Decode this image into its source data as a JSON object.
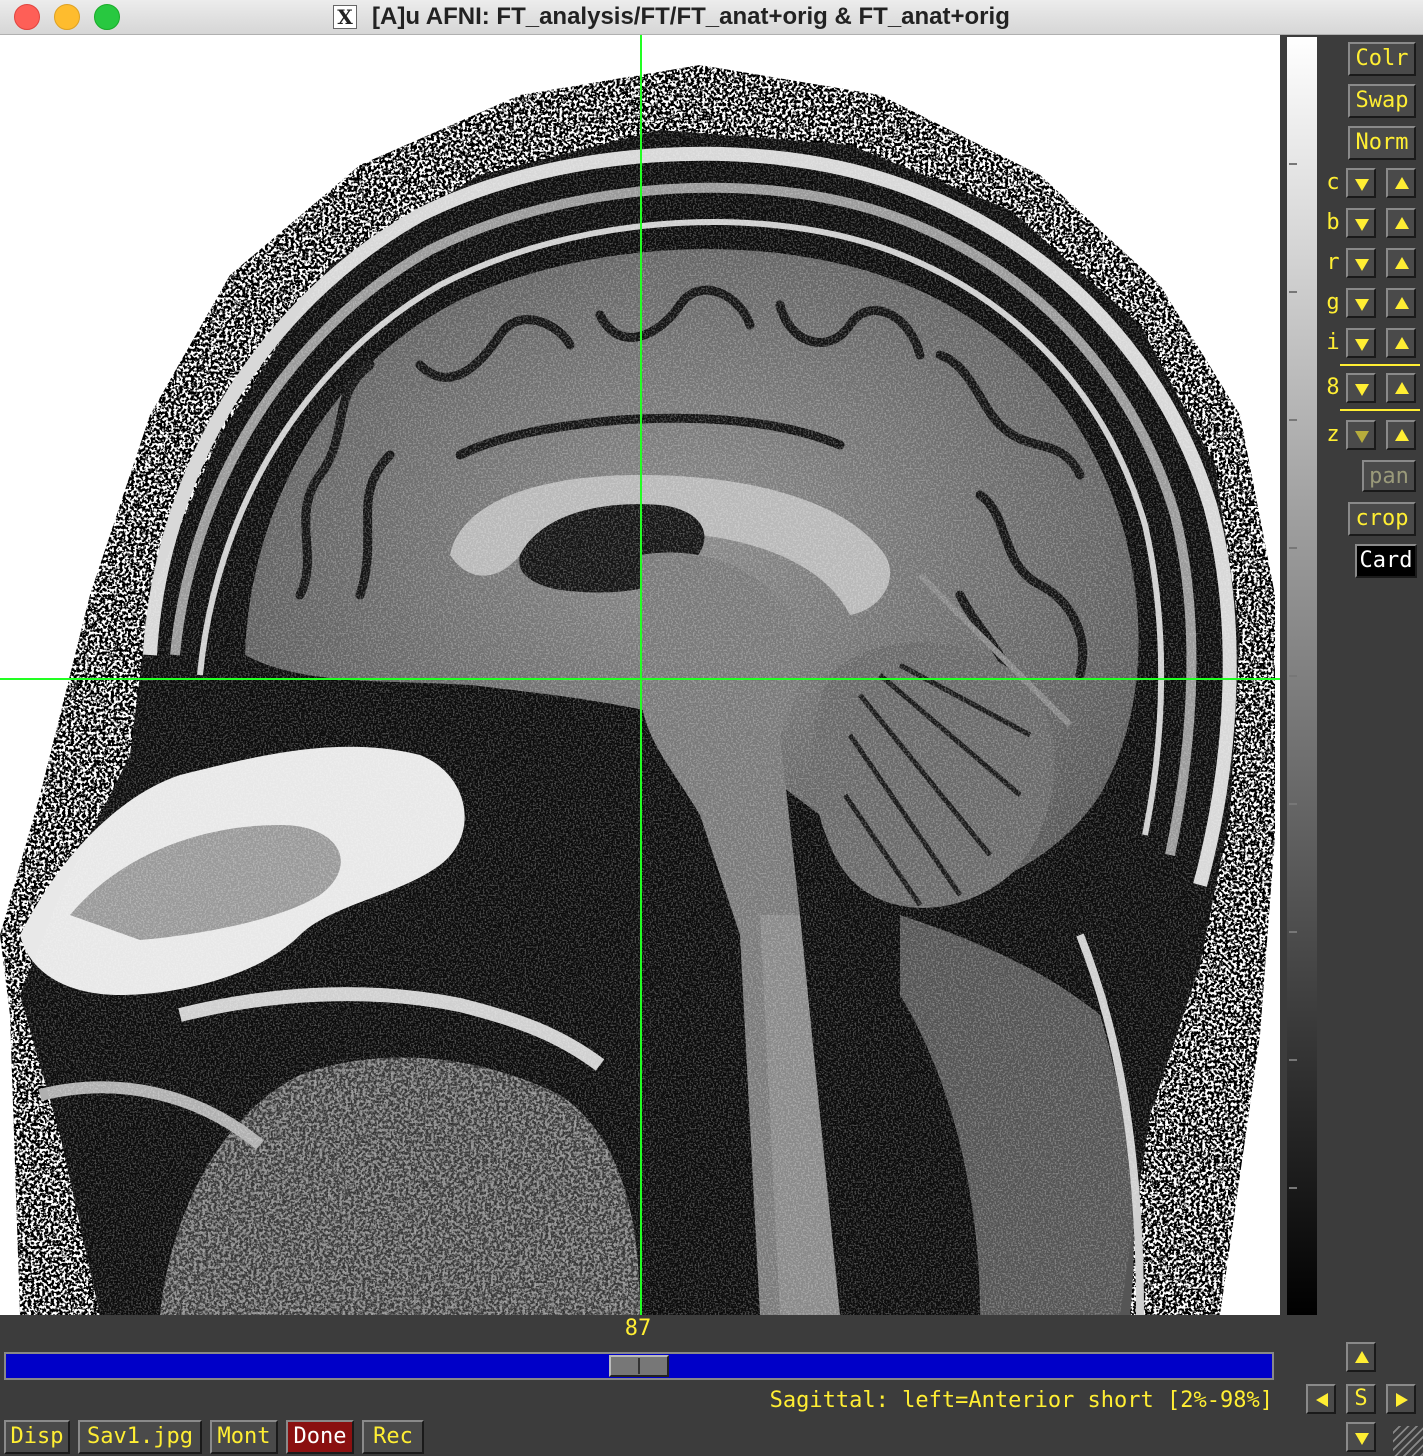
{
  "window": {
    "title": "[A]u AFNI: FT_analysis/FT/FT_anat+orig & FT_anat+orig",
    "x_icon": "X"
  },
  "image": {
    "description_icon": "mri-sagittal-brain",
    "crosshair_color": "#22ff22"
  },
  "side_buttons": {
    "colr": "Colr",
    "swap": "Swap",
    "norm": "Norm",
    "pan": "pan",
    "crop": "crop",
    "card": "Card"
  },
  "side_rows": [
    {
      "letter": "c"
    },
    {
      "letter": "b"
    },
    {
      "letter": "r"
    },
    {
      "letter": "g"
    },
    {
      "letter": "i"
    },
    {
      "letter": "8"
    },
    {
      "letter": "z"
    }
  ],
  "slice": {
    "number": "87",
    "position_fraction": 0.5
  },
  "status_text": "Sagittal: left=Anterior short [2%-98%]",
  "nav": {
    "s_label": "S"
  },
  "bottom_buttons": {
    "disp": "Disp",
    "save": "Sav1.jpg",
    "mont": "Mont",
    "done": "Done",
    "rec": "Rec"
  },
  "colors": {
    "label_yellow": "#ffee33",
    "slider_blue": "#0000c8",
    "panel_bg": "#3c3c3c",
    "done_red": "#8a1010"
  }
}
